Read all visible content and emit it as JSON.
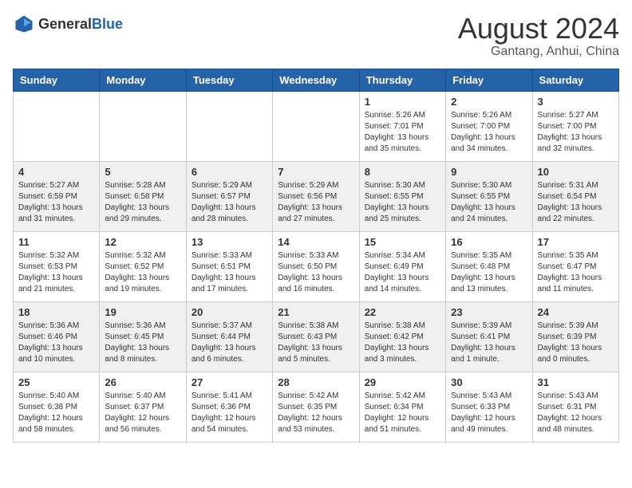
{
  "logo": {
    "general": "General",
    "blue": "Blue"
  },
  "title": {
    "month_year": "August 2024",
    "location": "Gantang, Anhui, China"
  },
  "headers": [
    "Sunday",
    "Monday",
    "Tuesday",
    "Wednesday",
    "Thursday",
    "Friday",
    "Saturday"
  ],
  "weeks": [
    [
      {
        "day": "",
        "info": ""
      },
      {
        "day": "",
        "info": ""
      },
      {
        "day": "",
        "info": ""
      },
      {
        "day": "",
        "info": ""
      },
      {
        "day": "1",
        "info": "Sunrise: 5:26 AM\nSunset: 7:01 PM\nDaylight: 13 hours\nand 35 minutes."
      },
      {
        "day": "2",
        "info": "Sunrise: 5:26 AM\nSunset: 7:00 PM\nDaylight: 13 hours\nand 34 minutes."
      },
      {
        "day": "3",
        "info": "Sunrise: 5:27 AM\nSunset: 7:00 PM\nDaylight: 13 hours\nand 32 minutes."
      }
    ],
    [
      {
        "day": "4",
        "info": "Sunrise: 5:27 AM\nSunset: 6:59 PM\nDaylight: 13 hours\nand 31 minutes."
      },
      {
        "day": "5",
        "info": "Sunrise: 5:28 AM\nSunset: 6:58 PM\nDaylight: 13 hours\nand 29 minutes."
      },
      {
        "day": "6",
        "info": "Sunrise: 5:29 AM\nSunset: 6:57 PM\nDaylight: 13 hours\nand 28 minutes."
      },
      {
        "day": "7",
        "info": "Sunrise: 5:29 AM\nSunset: 6:56 PM\nDaylight: 13 hours\nand 27 minutes."
      },
      {
        "day": "8",
        "info": "Sunrise: 5:30 AM\nSunset: 6:55 PM\nDaylight: 13 hours\nand 25 minutes."
      },
      {
        "day": "9",
        "info": "Sunrise: 5:30 AM\nSunset: 6:55 PM\nDaylight: 13 hours\nand 24 minutes."
      },
      {
        "day": "10",
        "info": "Sunrise: 5:31 AM\nSunset: 6:54 PM\nDaylight: 13 hours\nand 22 minutes."
      }
    ],
    [
      {
        "day": "11",
        "info": "Sunrise: 5:32 AM\nSunset: 6:53 PM\nDaylight: 13 hours\nand 21 minutes."
      },
      {
        "day": "12",
        "info": "Sunrise: 5:32 AM\nSunset: 6:52 PM\nDaylight: 13 hours\nand 19 minutes."
      },
      {
        "day": "13",
        "info": "Sunrise: 5:33 AM\nSunset: 6:51 PM\nDaylight: 13 hours\nand 17 minutes."
      },
      {
        "day": "14",
        "info": "Sunrise: 5:33 AM\nSunset: 6:50 PM\nDaylight: 13 hours\nand 16 minutes."
      },
      {
        "day": "15",
        "info": "Sunrise: 5:34 AM\nSunset: 6:49 PM\nDaylight: 13 hours\nand 14 minutes."
      },
      {
        "day": "16",
        "info": "Sunrise: 5:35 AM\nSunset: 6:48 PM\nDaylight: 13 hours\nand 13 minutes."
      },
      {
        "day": "17",
        "info": "Sunrise: 5:35 AM\nSunset: 6:47 PM\nDaylight: 13 hours\nand 11 minutes."
      }
    ],
    [
      {
        "day": "18",
        "info": "Sunrise: 5:36 AM\nSunset: 6:46 PM\nDaylight: 13 hours\nand 10 minutes."
      },
      {
        "day": "19",
        "info": "Sunrise: 5:36 AM\nSunset: 6:45 PM\nDaylight: 13 hours\nand 8 minutes."
      },
      {
        "day": "20",
        "info": "Sunrise: 5:37 AM\nSunset: 6:44 PM\nDaylight: 13 hours\nand 6 minutes."
      },
      {
        "day": "21",
        "info": "Sunrise: 5:38 AM\nSunset: 6:43 PM\nDaylight: 13 hours\nand 5 minutes."
      },
      {
        "day": "22",
        "info": "Sunrise: 5:38 AM\nSunset: 6:42 PM\nDaylight: 13 hours\nand 3 minutes."
      },
      {
        "day": "23",
        "info": "Sunrise: 5:39 AM\nSunset: 6:41 PM\nDaylight: 13 hours\nand 1 minute."
      },
      {
        "day": "24",
        "info": "Sunrise: 5:39 AM\nSunset: 6:39 PM\nDaylight: 13 hours\nand 0 minutes."
      }
    ],
    [
      {
        "day": "25",
        "info": "Sunrise: 5:40 AM\nSunset: 6:38 PM\nDaylight: 12 hours\nand 58 minutes."
      },
      {
        "day": "26",
        "info": "Sunrise: 5:40 AM\nSunset: 6:37 PM\nDaylight: 12 hours\nand 56 minutes."
      },
      {
        "day": "27",
        "info": "Sunrise: 5:41 AM\nSunset: 6:36 PM\nDaylight: 12 hours\nand 54 minutes."
      },
      {
        "day": "28",
        "info": "Sunrise: 5:42 AM\nSunset: 6:35 PM\nDaylight: 12 hours\nand 53 minutes."
      },
      {
        "day": "29",
        "info": "Sunrise: 5:42 AM\nSunset: 6:34 PM\nDaylight: 12 hours\nand 51 minutes."
      },
      {
        "day": "30",
        "info": "Sunrise: 5:43 AM\nSunset: 6:33 PM\nDaylight: 12 hours\nand 49 minutes."
      },
      {
        "day": "31",
        "info": "Sunrise: 5:43 AM\nSunset: 6:31 PM\nDaylight: 12 hours\nand 48 minutes."
      }
    ]
  ]
}
